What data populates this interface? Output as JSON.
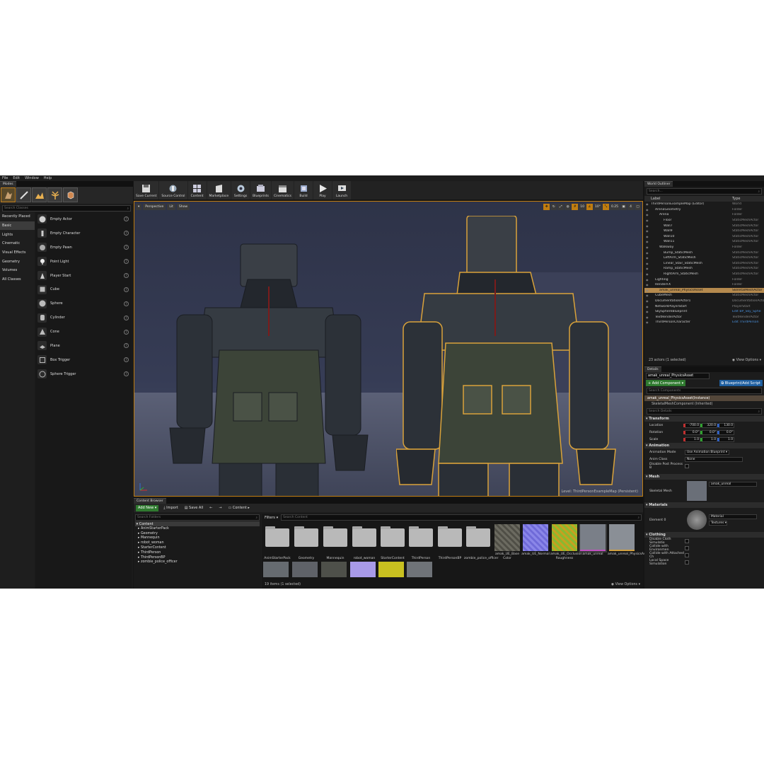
{
  "menubar": [
    "File",
    "Edit",
    "Window",
    "Help"
  ],
  "modes": {
    "tab": "Modes",
    "search_placeholder": "Search Classes",
    "categories": [
      "Recently Placed",
      "Basic",
      "Lights",
      "Cinematic",
      "Visual Effects",
      "Geometry",
      "Volumes",
      "All Classes"
    ],
    "items": [
      "Empty Actor",
      "Empty Character",
      "Empty Pawn",
      "Point Light",
      "Player Start",
      "Cube",
      "Sphere",
      "Cylinder",
      "Cone",
      "Plane",
      "Box Trigger",
      "Sphere Trigger"
    ]
  },
  "toolbar": {
    "buttons": [
      "Save Current",
      "Source Control",
      "Content",
      "Marketplace",
      "Settings",
      "Blueprints",
      "Cinematics",
      "Build",
      "Play",
      "Launch"
    ]
  },
  "viewport": {
    "perspective": "Perspective",
    "lit": "Lit",
    "show": "Show",
    "grid_snap": "10",
    "rot_snap": "10°",
    "scale_snap": "0.25",
    "camera_speed": "4",
    "level_label": "Level: ThirdPersonExampleMap (Persistent)"
  },
  "content_browser": {
    "tab": "Content Browser",
    "add_new": "Add New",
    "import": "Import",
    "save_all": "Save All",
    "path": "Content",
    "search_folders": "Search Folders",
    "filters": "Filters",
    "search_content": "Search Content",
    "tree_root": "Content",
    "tree": [
      "AnimStarterPack",
      "Geometry",
      "Mannequin",
      "robot_woman",
      "StarterContent",
      "ThirdPerson",
      "ThirdPersonBP",
      "zombie_police_officer"
    ],
    "folders": [
      "AnimStarterPack",
      "Geometry",
      "Mannequin",
      "robot_woman",
      "StarterContent",
      "ThirdPerson",
      "ThirdPersonBP",
      "zombie_police_officer"
    ],
    "assets": [
      "amak_UE_Base Color",
      "amak_UE_Normal",
      "amak_UE_Occlusion Roughness",
      "amak_unreal",
      "amak_unreal_PhysicsAsset"
    ],
    "status": "19 items (1 selected)",
    "view_options": "View Options"
  },
  "outliner": {
    "tab": "World Outliner",
    "search_placeholder": "Search...",
    "col_label": "Label",
    "col_type": "Type",
    "rows": [
      {
        "label": "ThirdPersonExampleMap (Editor)",
        "type": "World"
      },
      {
        "label": "ArenaGeometry",
        "type": "Folder"
      },
      {
        "label": "Arena",
        "type": "Folder"
      },
      {
        "label": "Floor",
        "type": "StaticMeshActor"
      },
      {
        "label": "Wall7",
        "type": "StaticMeshActor"
      },
      {
        "label": "Wall9",
        "type": "StaticMeshActor"
      },
      {
        "label": "Wall10",
        "type": "StaticMeshActor"
      },
      {
        "label": "Wall11",
        "type": "StaticMeshActor"
      },
      {
        "label": "Walkway",
        "type": "Folder"
      },
      {
        "label": "Bump_StaticMesh",
        "type": "StaticMeshActor"
      },
      {
        "label": "LeftArm_StaticMesh",
        "type": "StaticMeshActor"
      },
      {
        "label": "Linear_Stair_StaticMesh",
        "type": "StaticMeshActor"
      },
      {
        "label": "Ramp_StaticMesh",
        "type": "StaticMeshActor"
      },
      {
        "label": "RightArm_StaticMesh",
        "type": "StaticMeshActor"
      },
      {
        "label": "Lighting",
        "type": "Folder"
      },
      {
        "label": "RenderFX",
        "type": "Folder"
      },
      {
        "label": "amak_unreal_PhysicsAsset",
        "type": "SkeletalMeshActor"
      },
      {
        "label": "CubeMesh",
        "type": "StaticMeshActor"
      },
      {
        "label": "DocumentationActor1",
        "type": "DocumentationActor"
      },
      {
        "label": "NetworkPlayerStart",
        "type": "PlayerStart"
      },
      {
        "label": "SkySphereBlueprint",
        "type": "Edit BP_Sky_Sphe"
      },
      {
        "label": "TextRenderActor",
        "type": "TextRenderActor"
      },
      {
        "label": "ThirdPersonCharacter",
        "type": "Edit ThirdPerson"
      }
    ],
    "status": "23 actors (1 selected)",
    "view_options": "View Options"
  },
  "details": {
    "tab": "Details",
    "name": "amak_unreal_PhysicsAsset",
    "add_component": "+ Add Component",
    "blueprint": "Blueprint/Add Script",
    "search_components": "Search Components",
    "instance": "amak_unreal_PhysicsAsset(Instance)",
    "component": "SkeletalMeshComponent (Inherited)",
    "search_details": "Search Details",
    "transform": "Transform",
    "location_label": "Location",
    "location": [
      "-700.0",
      "320.0",
      "130.0"
    ],
    "rotation_label": "Rotation",
    "rotation": [
      "0.0°",
      "0.0°",
      "0.0°"
    ],
    "scale_label": "Scale",
    "scale": [
      "1.0",
      "1.0",
      "1.0"
    ],
    "animation": "Animation",
    "anim_mode_label": "Animation Mode",
    "anim_mode": "Use Animation Blueprint",
    "anim_class_label": "Anim Class",
    "anim_class": "None",
    "post_process_label": "Disable Post Process B",
    "mesh": "Mesh",
    "skeletal_mesh_label": "Skeletal Mesh",
    "skeletal_mesh": "amak_unreal",
    "materials": "Materials",
    "element_label": "Element 0",
    "material": "Material",
    "textures": "Textures",
    "clothing": "Clothing",
    "cloth_rows": [
      "Disable Cloth Simulatio",
      "Collide with Environmen",
      "Collide with Attached Ch",
      "Local Space Simulation"
    ]
  }
}
